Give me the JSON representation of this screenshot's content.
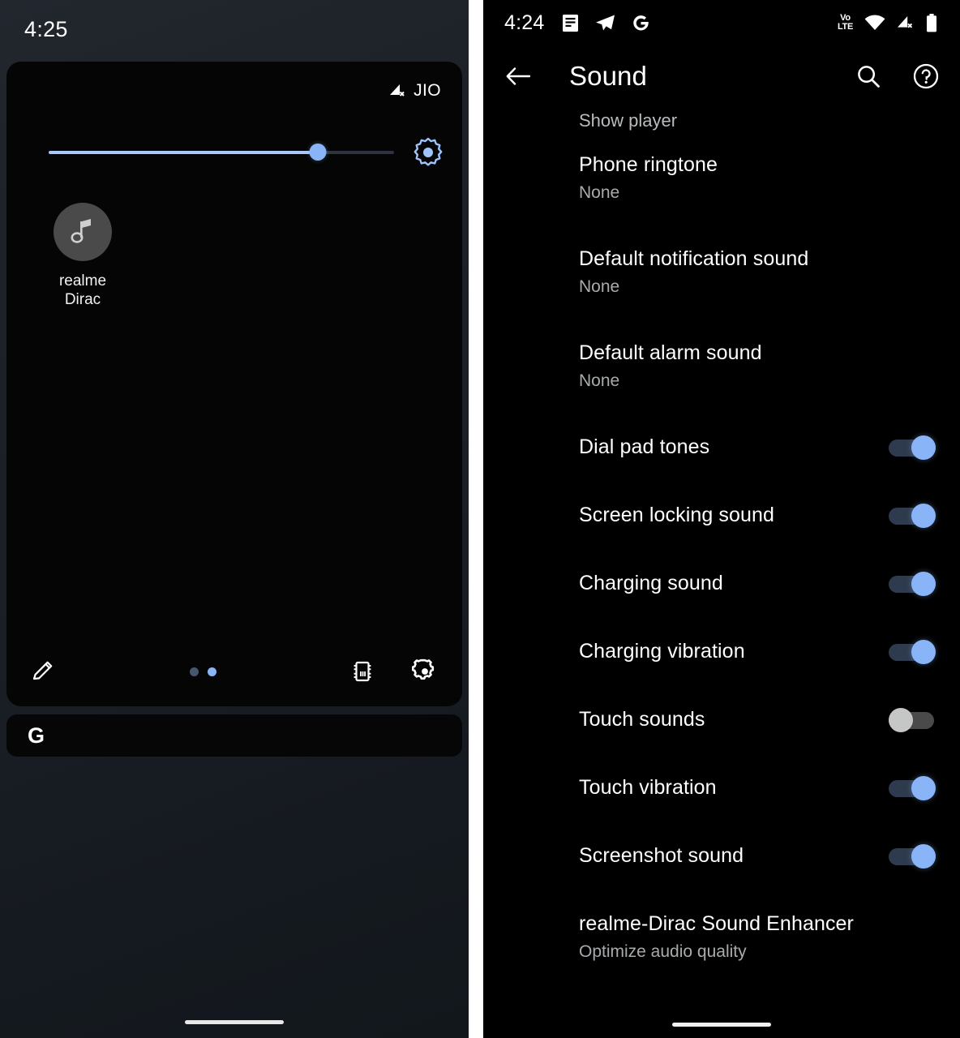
{
  "left_panel": {
    "status_bar": {
      "clock": "4:25"
    },
    "quick_settings": {
      "carrier": "JIO",
      "carrier_signal_icon": "signal-no-service-icon",
      "brightness": {
        "icon": "auto-brightness-icon",
        "value_percent": 78
      },
      "media": {
        "thumb_icon": "music-note-icon",
        "line1": "realme",
        "line2": "Dirac"
      },
      "bottom_bar": {
        "edit_icon": "pencil-edit-icon",
        "page_dots": [
          {
            "label": "page-1",
            "active": false
          },
          {
            "label": "page-2",
            "active": true
          }
        ],
        "memory_icon": "memory-chip-icon",
        "settings_icon": "gear-icon"
      }
    },
    "search_bar": {
      "logo": "G",
      "logo_icon": "google-g-icon"
    },
    "home_indicator": "home-indicator"
  },
  "right_panel": {
    "status_bar": {
      "clock": "4:24",
      "notification_icons": [
        "notes-icon",
        "telegram-icon",
        "google-g-icon"
      ],
      "system_icons": [
        "volte-icon",
        "wifi-icon",
        "cellular-no-service-icon",
        "battery-icon"
      ],
      "volte_line1": "Vo",
      "volte_line2": "LTE"
    },
    "toolbar": {
      "back_icon": "back-arrow-icon",
      "title": "Sound",
      "search_icon": "search-icon",
      "help_icon": "help-circle-icon"
    },
    "partial_top_item": "Show player",
    "items": [
      {
        "title": "Phone ringtone",
        "sub": "None",
        "type": "two-line"
      },
      {
        "title": "Default notification sound",
        "sub": "None",
        "type": "two-line"
      },
      {
        "title": "Default alarm sound",
        "sub": "None",
        "type": "two-line"
      },
      {
        "title": "Dial pad tones",
        "type": "switch",
        "on": true
      },
      {
        "title": "Screen locking sound",
        "type": "switch",
        "on": true
      },
      {
        "title": "Charging sound",
        "type": "switch",
        "on": true
      },
      {
        "title": "Charging vibration",
        "type": "switch",
        "on": true
      },
      {
        "title": "Touch sounds",
        "type": "switch",
        "on": false
      },
      {
        "title": "Touch vibration",
        "type": "switch",
        "on": true
      },
      {
        "title": "Screenshot sound",
        "type": "switch",
        "on": true
      },
      {
        "title": "realme-Dirac Sound Enhancer",
        "sub": "Optimize audio quality",
        "type": "two-line"
      }
    ],
    "home_indicator": "home-indicator"
  },
  "colors": {
    "accent_blue": "#8ab4f8",
    "switch_on_track": "#2e3b4e",
    "switch_off_thumb": "#c4c7c5",
    "screen_bg_dark": "#000000",
    "shade_bg": "#1c2228"
  }
}
